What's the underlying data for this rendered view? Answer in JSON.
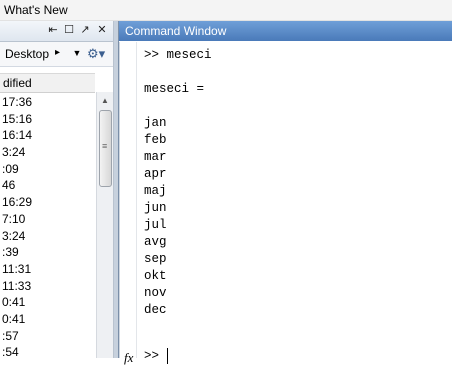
{
  "menubar": {
    "whats_new": "What's New"
  },
  "left_panel": {
    "titlebar_buttons": [
      "⇤",
      "☐",
      "↗",
      "✕"
    ],
    "path": "Desktop",
    "path_arrow": "▸",
    "dropdown": "▼",
    "gear": "⚙▾",
    "column_header": "dified",
    "rows": [
      "17:36",
      "15:16",
      "16:14",
      "3:24",
      ":09",
      "46",
      "16:29",
      "7:10",
      "3:24",
      ":39",
      "11:31",
      "11:33",
      "0:41",
      "0:41",
      ":57",
      ":54"
    ]
  },
  "command_window": {
    "title": "Command Window",
    "lines": [
      ">> meseci",
      "",
      "meseci =",
      "",
      "jan",
      "feb",
      "mar",
      "apr",
      "maj",
      "jun",
      "jul",
      "avg",
      "sep",
      "okt",
      "nov",
      "dec"
    ],
    "fx_label": "fx",
    "prompt": ">>"
  }
}
